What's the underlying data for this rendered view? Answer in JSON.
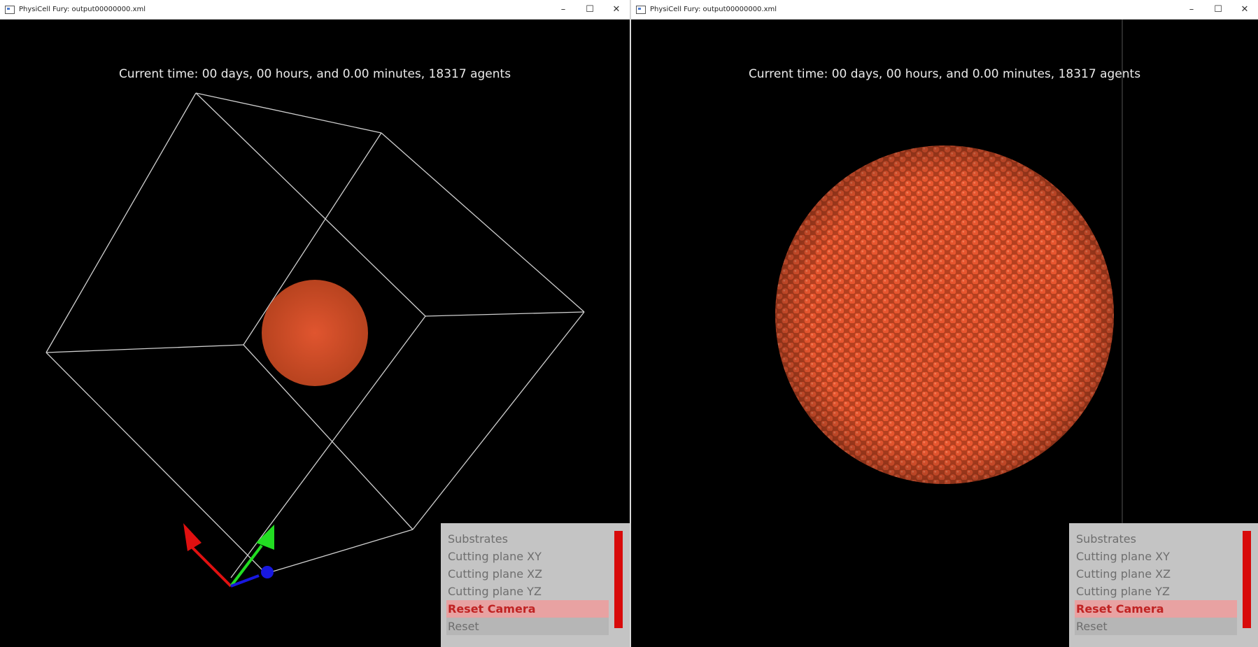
{
  "windows": [
    {
      "title": "PhysiCell Fury: output00000000.xml",
      "controls": {
        "minimize": "–",
        "maximize": "☐",
        "close": "✕"
      },
      "time_label": "Current time: 00 days, 00 hours, and 0.00 minutes, 18317 agents",
      "view": "3D domain box with axes",
      "menu": {
        "items": [
          {
            "label": "Substrates"
          },
          {
            "label": "Cutting plane XY"
          },
          {
            "label": "Cutting plane XZ"
          },
          {
            "label": "Cutting plane YZ"
          },
          {
            "label": "Reset Camera",
            "state": "highlighted"
          },
          {
            "label": "Reset"
          }
        ]
      }
    },
    {
      "title": "PhysiCell Fury: output00000000.xml",
      "controls": {
        "minimize": "–",
        "maximize": "☐",
        "close": "✕"
      },
      "time_label": "Current time: 00 days, 00 hours, and 0.00 minutes, 18317 agents",
      "view": "zoomed spherical tumor",
      "menu": {
        "items": [
          {
            "label": "Substrates"
          },
          {
            "label": "Cutting plane XY"
          },
          {
            "label": "Cutting plane XZ"
          },
          {
            "label": "Cutting plane YZ"
          },
          {
            "label": "Reset Camera",
            "state": "highlighted"
          },
          {
            "label": "Reset"
          }
        ]
      }
    }
  ],
  "colors": {
    "background": "#000000",
    "cell": "#e0552f",
    "box_edge": "#cfcfcf",
    "axis_x": "#e01010",
    "axis_y": "#22dd22",
    "axis_z": "#1818e0",
    "menu_bg": "#c4c4c4",
    "menu_highlight": "#e8a2a2",
    "scrollbar": "#d80a0a"
  }
}
